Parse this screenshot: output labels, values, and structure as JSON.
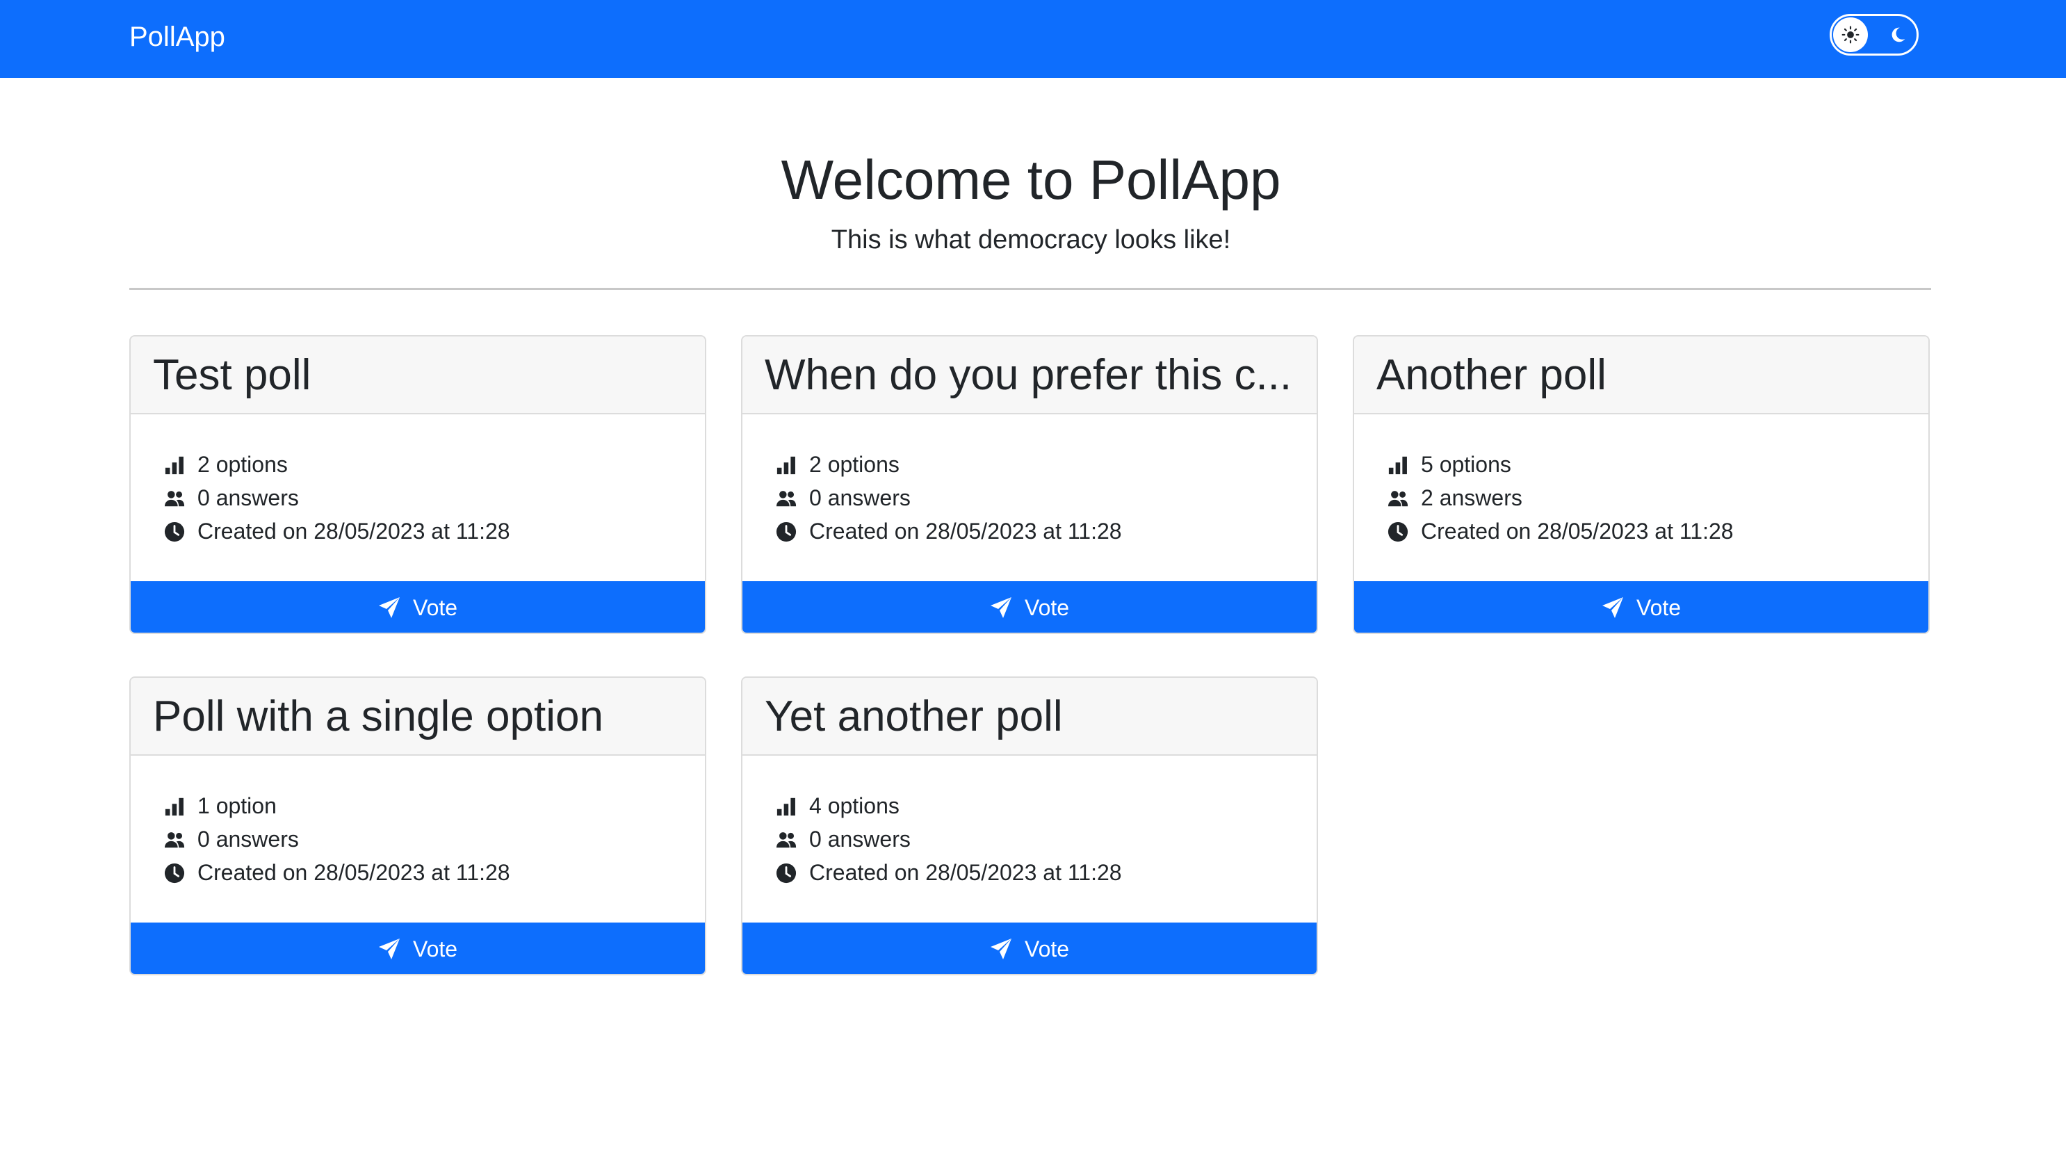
{
  "navbar": {
    "brand": "PollApp",
    "theme_toggle": {
      "light_icon": "sun-icon",
      "dark_icon": "moon-icon",
      "selected": "light"
    }
  },
  "hero": {
    "title": "Welcome to PollApp",
    "subtitle": "This is what democracy looks like!"
  },
  "colors": {
    "primary": "#0d6efd",
    "card_header": "#f7f7f7",
    "text": "#212529"
  },
  "polls": [
    {
      "title": "Test poll",
      "options": "2 options",
      "answers": "0 answers",
      "created": "Created on 28/05/2023 at 11:28",
      "vote_label": "Vote"
    },
    {
      "title": "When do you prefer this c...",
      "options": "2 options",
      "answers": "0 answers",
      "created": "Created on 28/05/2023 at 11:28",
      "vote_label": "Vote"
    },
    {
      "title": "Another poll",
      "options": "5 options",
      "answers": "2 answers",
      "created": "Created on 28/05/2023 at 11:28",
      "vote_label": "Vote"
    },
    {
      "title": "Poll with a single option",
      "options": "1 option",
      "answers": "0 answers",
      "created": "Created on 28/05/2023 at 11:28",
      "vote_label": "Vote"
    },
    {
      "title": "Yet another poll",
      "options": "4 options",
      "answers": "0 answers",
      "created": "Created on 28/05/2023 at 11:28",
      "vote_label": "Vote"
    }
  ],
  "icons": {
    "options": "bar-chart-icon",
    "answers": "users-icon",
    "created": "clock-icon",
    "vote": "send-icon"
  }
}
